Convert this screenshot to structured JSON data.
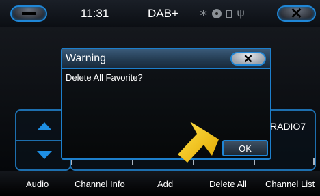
{
  "topbar": {
    "time": "11:31",
    "source": "DAB+",
    "icons": [
      "bluetooth-icon",
      "disc-icon",
      "sd-card-icon",
      "usb-icon"
    ]
  },
  "background": {
    "station_text": "RADIO7"
  },
  "dialog": {
    "title": "Warning",
    "message": "Delete All Favorite?",
    "ok_label": "OK"
  },
  "bottom_bar": {
    "items": [
      "Audio",
      "Channel Info",
      "Add",
      "Delete All",
      "Channel List"
    ]
  },
  "colors": {
    "accent_blue": "#1d7fcc",
    "pointer_yellow": "#f2c400",
    "icon_gray": "#8b9096"
  }
}
